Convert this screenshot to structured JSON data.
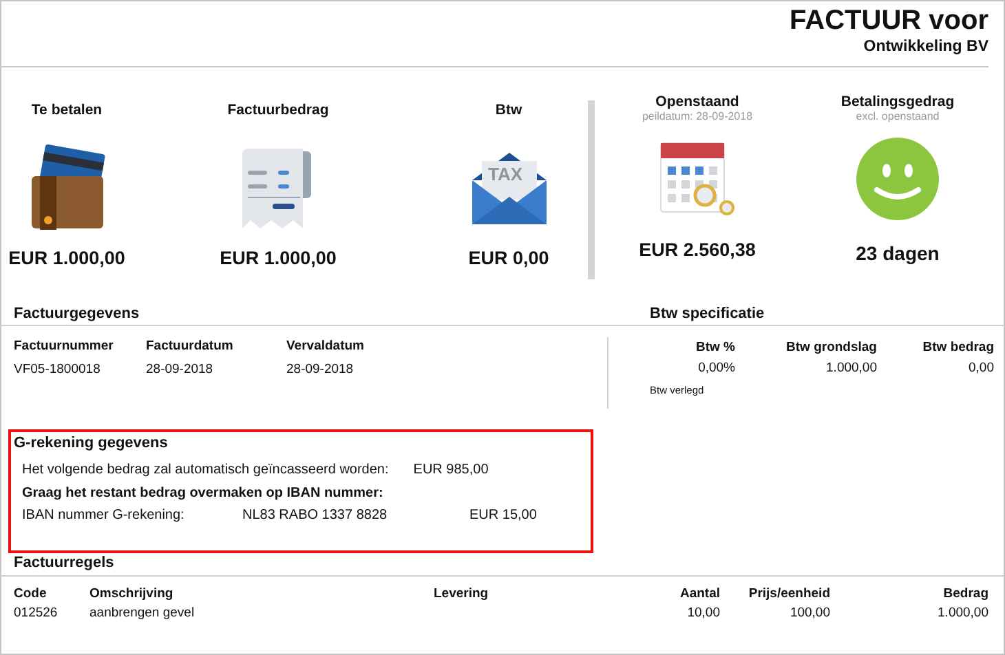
{
  "header": {
    "title": "FACTUUR voor",
    "subtitle": "Ontwikkeling BV"
  },
  "kpis": [
    {
      "label": "Te betalen",
      "value": "EUR 1.000,00"
    },
    {
      "label": "Factuurbedrag",
      "value": "EUR 1.000,00"
    },
    {
      "label": "Btw",
      "value": "EUR 0,00",
      "icon_text": "TAX"
    },
    {
      "label": "Openstaand",
      "note": "peildatum: 28-09-2018",
      "value": "EUR 2.560,38"
    },
    {
      "label": "Betalingsgedrag",
      "note": "excl. openstaand",
      "value": "23 dagen"
    }
  ],
  "factuurgegevens": {
    "title": "Factuurgegevens",
    "columns": [
      "Factuurnummer",
      "Factuurdatum",
      "Vervaldatum"
    ],
    "values": [
      "VF05-1800018",
      "28-09-2018",
      "28-09-2018"
    ]
  },
  "btw": {
    "title": "Btw specificatie",
    "columns": [
      "Btw %",
      "Btw grondslag",
      "Btw bedrag"
    ],
    "values": [
      "0,00%",
      "1.000,00",
      "0,00"
    ],
    "note": "Btw verlegd"
  },
  "g_rekening": {
    "title": "G-rekening gegevens",
    "line1": "Het volgende bedrag zal automatisch geïncasseerd worden:",
    "amount1": "EUR 985,00",
    "instruction": "Graag het restant bedrag overmaken op IBAN nummer:",
    "iban_label": "IBAN nummer G-rekening:",
    "iban": "NL83 RABO 1337 8828",
    "amount2": "EUR 15,00"
  },
  "factuurregels": {
    "title": "Factuurregels",
    "columns": [
      "Code",
      "Omschrijving",
      "Levering",
      "Aantal",
      "Prijs/eenheid",
      "Bedrag"
    ],
    "rows": [
      {
        "code": "012526",
        "description": "aanbrengen gevel",
        "quantity": "10,00",
        "price": "100,00",
        "amount": "1.000,00"
      }
    ]
  }
}
